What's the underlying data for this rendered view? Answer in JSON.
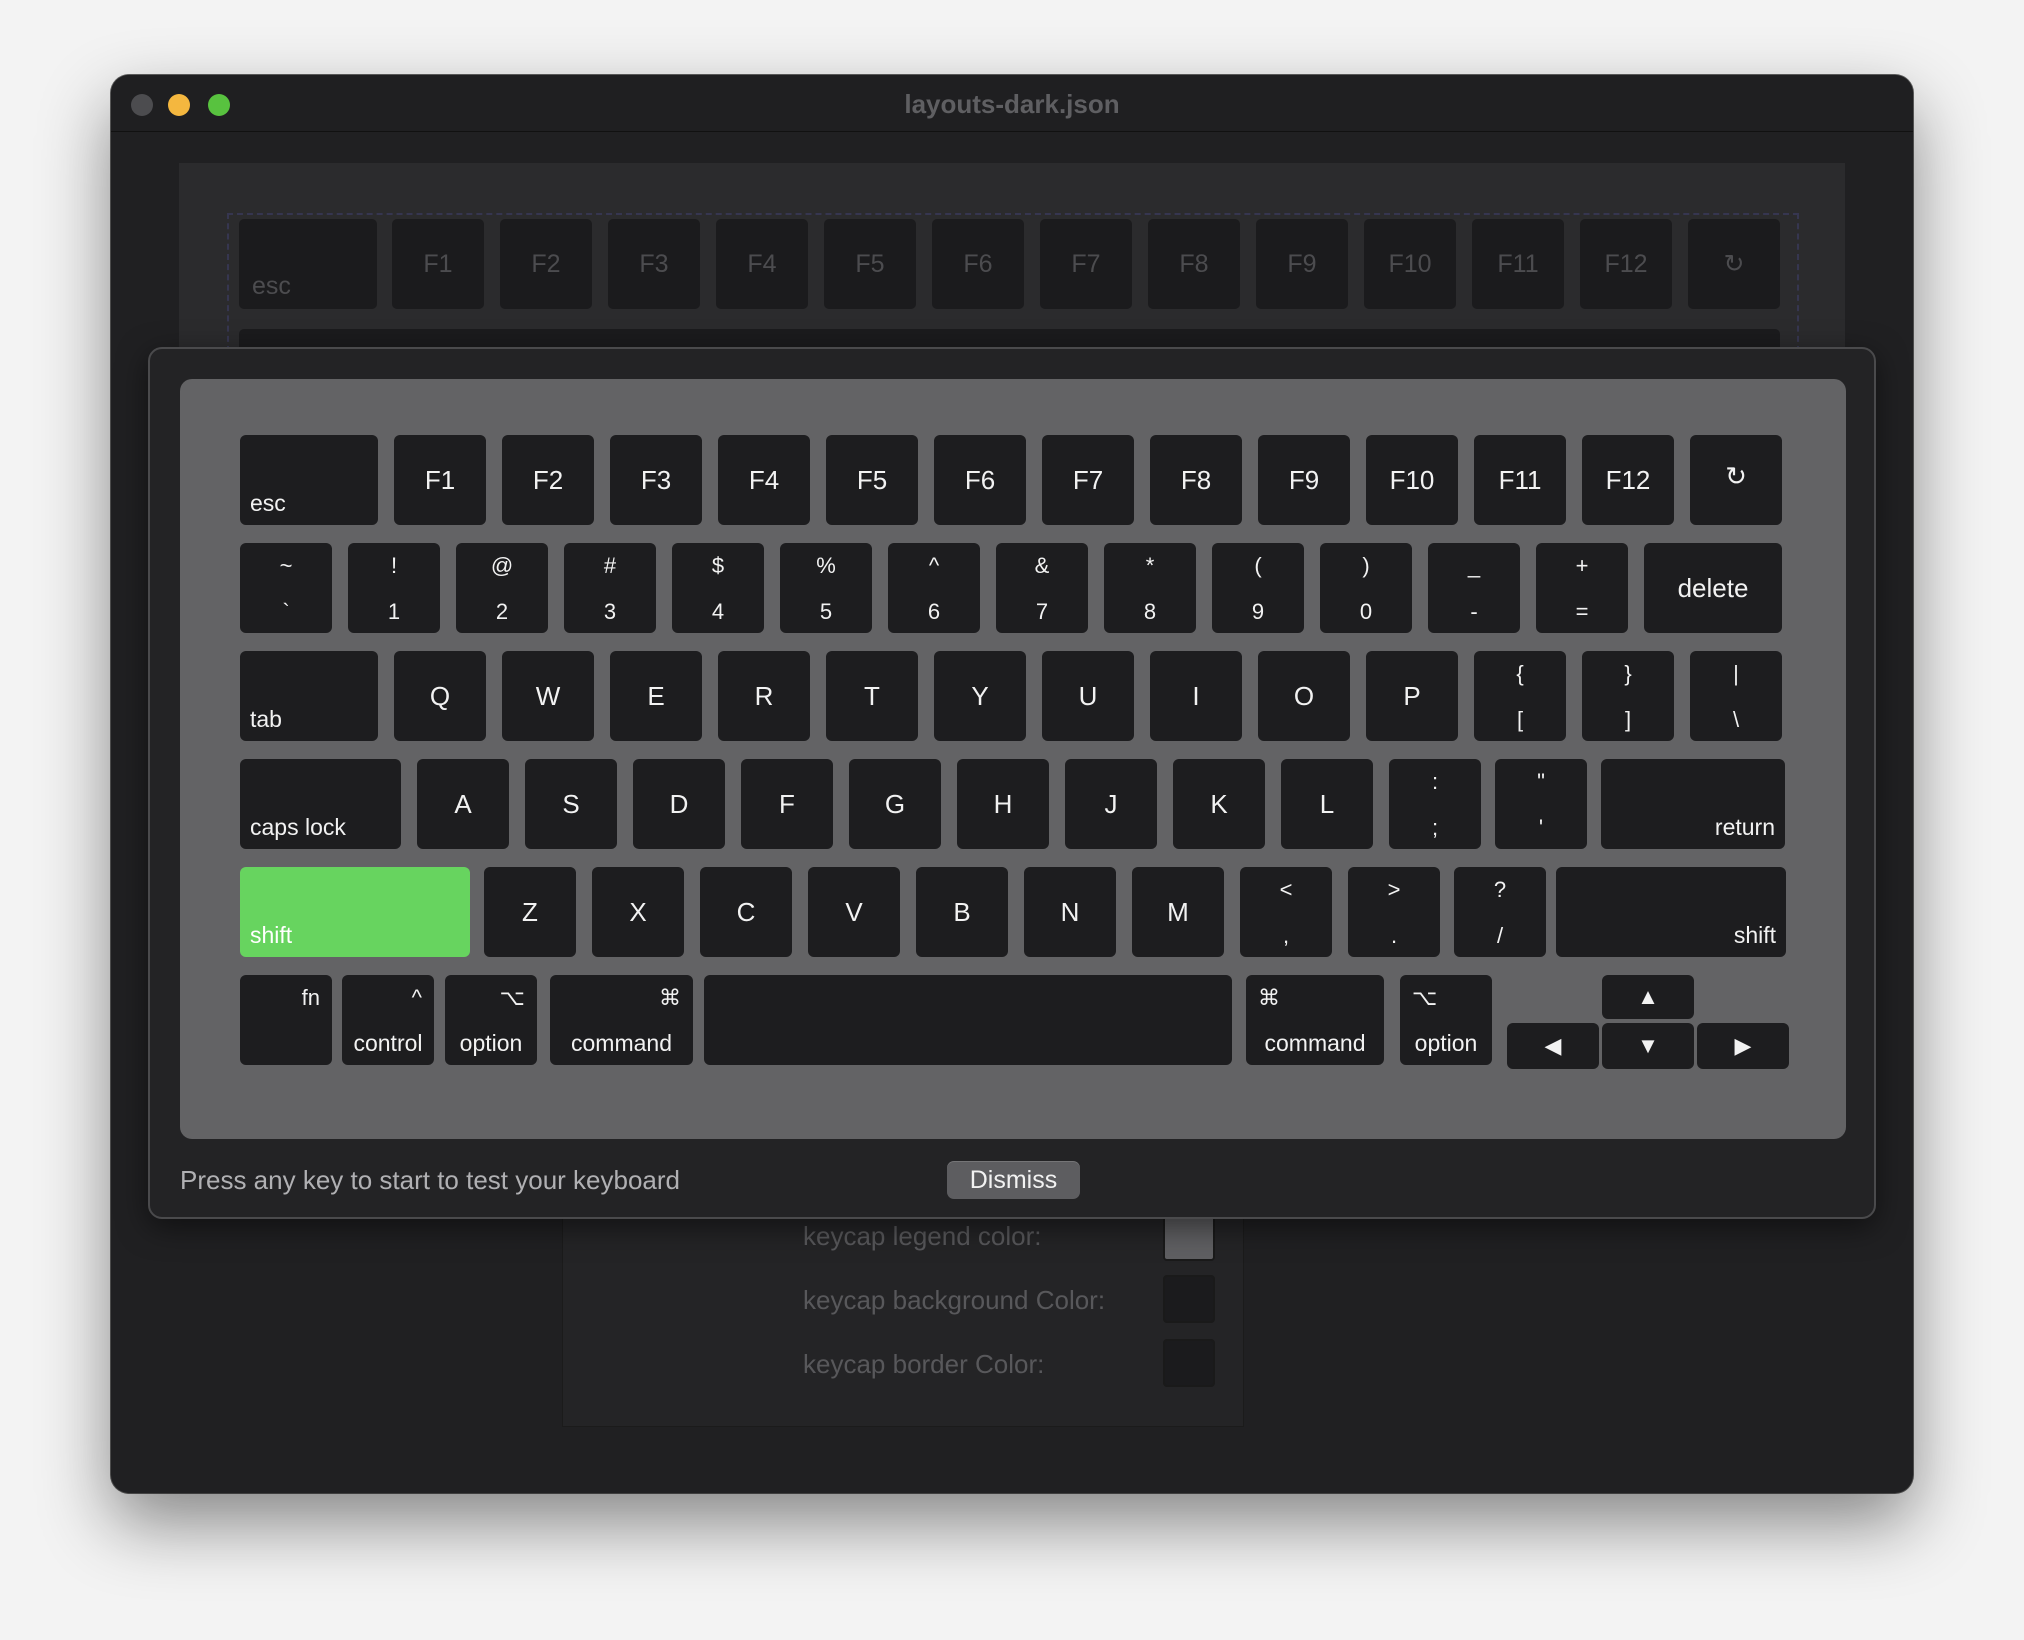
{
  "window": {
    "title": "layouts-dark.json"
  },
  "background_keyboard": {
    "row1": [
      "esc",
      "F1",
      "F2",
      "F3",
      "F4",
      "F5",
      "F6",
      "F7",
      "F8",
      "F9",
      "F10",
      "F11",
      "F12",
      "↻"
    ]
  },
  "properties": {
    "legend_label": "keycap legend color:",
    "background_label": "keycap background Color:",
    "border_label": "keycap border Color:",
    "legend_color": "#5f5f62",
    "background_color": "#1b1b1d",
    "border_color": "#1b1b1d"
  },
  "keyboard": {
    "fn_row": [
      "esc",
      "F1",
      "F2",
      "F3",
      "F4",
      "F5",
      "F6",
      "F7",
      "F8",
      "F9",
      "F10",
      "F11",
      "F12",
      "↻"
    ],
    "number_row": [
      {
        "top": "~",
        "bottom": "`"
      },
      {
        "top": "!",
        "bottom": "1"
      },
      {
        "top": "@",
        "bottom": "2"
      },
      {
        "top": "#",
        "bottom": "3"
      },
      {
        "top": "$",
        "bottom": "4"
      },
      {
        "top": "%",
        "bottom": "5"
      },
      {
        "top": "^",
        "bottom": "6"
      },
      {
        "top": "&",
        "bottom": "7"
      },
      {
        "top": "*",
        "bottom": "8"
      },
      {
        "top": "(",
        "bottom": "9"
      },
      {
        "top": ")",
        "bottom": "0"
      },
      {
        "top": "_",
        "bottom": "-"
      },
      {
        "top": "+",
        "bottom": "="
      }
    ],
    "delete_label": "delete",
    "tab_label": "tab",
    "q_row": [
      "Q",
      "W",
      "E",
      "R",
      "T",
      "Y",
      "U",
      "I",
      "O",
      "P"
    ],
    "q_row_symbols": [
      {
        "top": "{",
        "bottom": "["
      },
      {
        "top": "}",
        "bottom": "]"
      },
      {
        "top": "|",
        "bottom": "\\"
      }
    ],
    "caps_label": "caps lock",
    "a_row": [
      "A",
      "S",
      "D",
      "F",
      "G",
      "H",
      "J",
      "K",
      "L"
    ],
    "a_row_symbols": [
      {
        "top": ":",
        "bottom": ";"
      },
      {
        "top": "\"",
        "bottom": "'"
      }
    ],
    "return_label": "return",
    "shift_left_label": "shift",
    "z_row": [
      "Z",
      "X",
      "C",
      "V",
      "B",
      "N",
      "M"
    ],
    "z_row_symbols": [
      {
        "top": "<",
        "bottom": ","
      },
      {
        "top": ">",
        "bottom": "."
      },
      {
        "top": "?",
        "bottom": "/"
      }
    ],
    "shift_right_label": "shift",
    "bottom_row": {
      "fn": "fn",
      "control": "control",
      "control_symbol": "^",
      "option": "option",
      "option_symbol": "⌥",
      "command": "command",
      "command_symbol": "⌘"
    },
    "arrows": {
      "up": "▲",
      "down": "▼",
      "left": "◀",
      "right": "▶"
    },
    "pressed_color": "#67d45f"
  },
  "status_text": "Press any key to start to test your keyboard",
  "dismiss_label": "Dismiss"
}
